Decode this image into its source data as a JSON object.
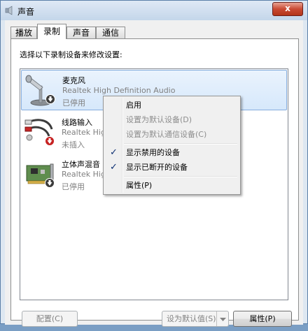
{
  "window": {
    "title": "声音",
    "close_label": "x"
  },
  "tabs": [
    {
      "label": "播放",
      "active": false
    },
    {
      "label": "录制",
      "active": true
    },
    {
      "label": "声音",
      "active": false
    },
    {
      "label": "通信",
      "active": false
    }
  ],
  "instruction": "选择以下录制设备来修改设置:",
  "devices": [
    {
      "name": "麦克风",
      "driver": "Realtek High Definition Audio",
      "status": "已停用",
      "icon": "microphone-icon",
      "selected": true
    },
    {
      "name": "线路输入",
      "driver": "Realtek High Definition Audio",
      "status": "未插入",
      "icon": "line-in-cable-icon",
      "selected": false
    },
    {
      "name": "立体声混音",
      "driver": "Realtek High Definition Audio",
      "status": "已停用",
      "icon": "sound-card-icon",
      "selected": false
    }
  ],
  "context_menu": {
    "items": [
      {
        "label": "启用",
        "disabled": false,
        "checked": false
      },
      {
        "label": "设置为默认设备(D)",
        "disabled": true,
        "checked": false
      },
      {
        "label": "设置为默认通信设备(C)",
        "disabled": true,
        "checked": false
      },
      {
        "label": "显示禁用的设备",
        "disabled": false,
        "checked": true
      },
      {
        "label": "显示已断开的设备",
        "disabled": false,
        "checked": true
      },
      {
        "label": "属性(P)",
        "disabled": false,
        "checked": false
      }
    ]
  },
  "buttons": {
    "configure": "配置(C)",
    "set_default": "设为默认值(S)",
    "properties": "属性(P)"
  }
}
